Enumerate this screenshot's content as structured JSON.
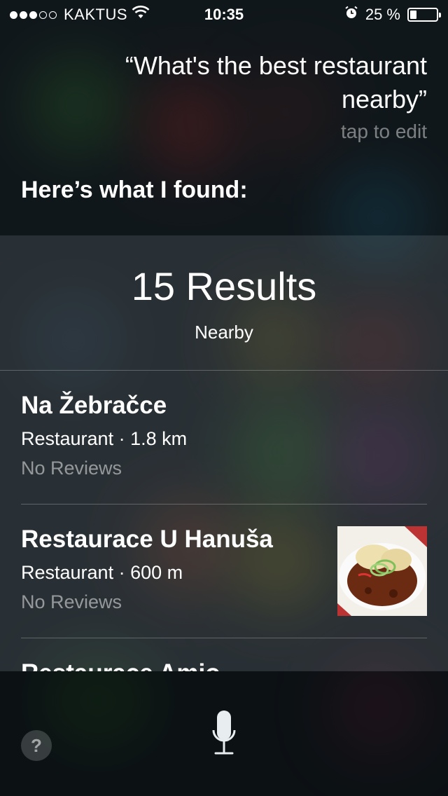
{
  "status_bar": {
    "carrier": "KAKTUS",
    "time": "10:35",
    "battery_text": "25 %",
    "battery_level": 0.25,
    "signal_bars": 3,
    "icons": [
      "wifi-icon",
      "alarm-icon",
      "battery-icon"
    ]
  },
  "siri": {
    "query": "“What's the best restaurant nearby”",
    "tap_to_edit": "tap to edit",
    "response": "Here’s what I found:"
  },
  "results": {
    "count_label": "15 Results",
    "subtitle": "Nearby",
    "items": [
      {
        "name": "Na Žebračce",
        "meta": "Restaurant · 1.8 km",
        "reviews": "No Reviews",
        "has_photo": false
      },
      {
        "name": "Restaurace U Hanuša",
        "meta": "Restaurant · 600 m",
        "reviews": "No Reviews",
        "has_photo": true
      },
      {
        "name": "Restaurace Amio",
        "meta": "",
        "reviews": "",
        "has_photo": false
      }
    ]
  },
  "bottom_bar": {
    "help_label": "?",
    "icons": [
      "help-icon",
      "microphone-icon"
    ]
  },
  "colors": {
    "background": "#1a2226",
    "text": "#ffffff",
    "muted_text": "#8a9096"
  }
}
